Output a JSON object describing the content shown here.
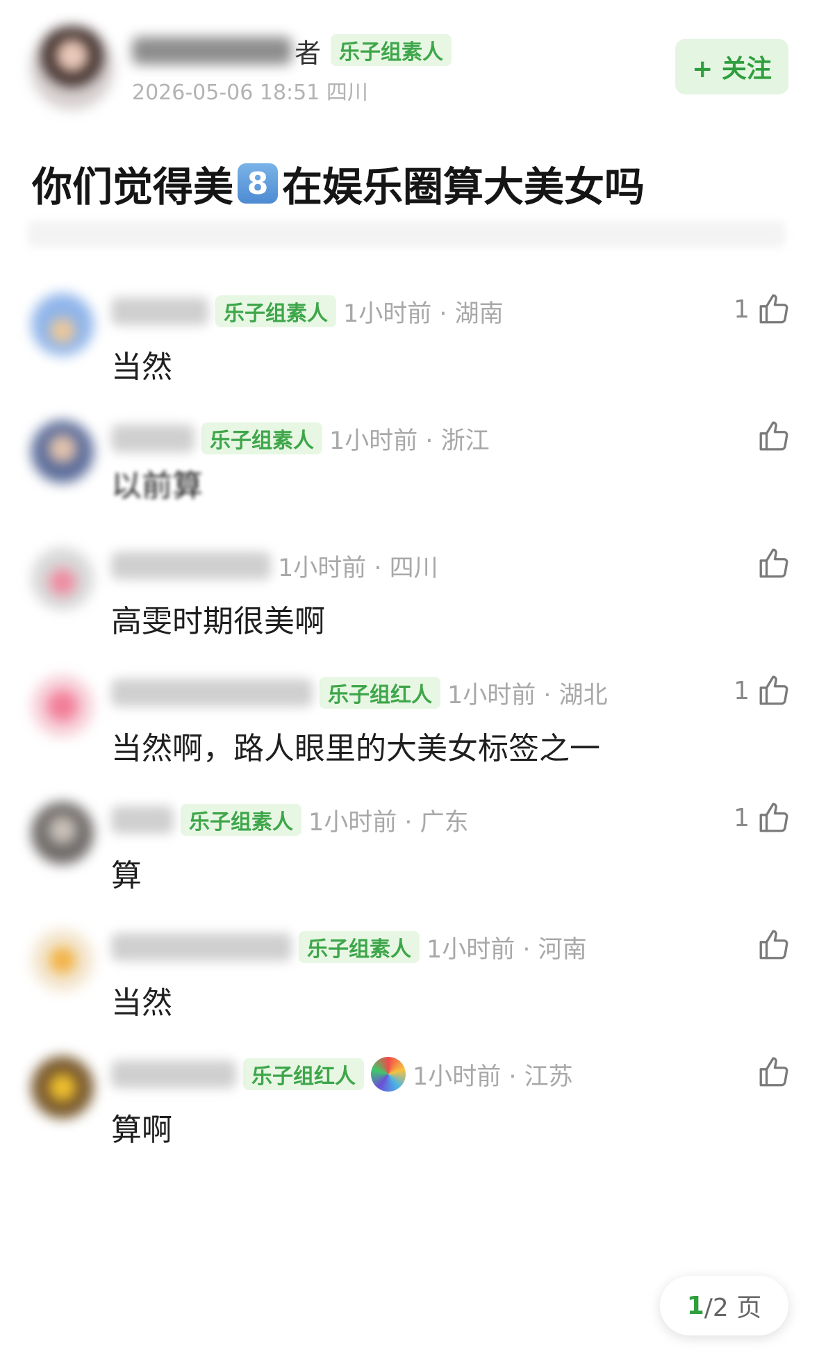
{
  "post": {
    "author_name_suffix": "者",
    "author_tag": "乐子组素人",
    "datetime": "2026-05-06 18:51",
    "location": "四川",
    "follow_label": "+ 关注",
    "title_before": "你们觉得美",
    "title_emoji": "8",
    "title_after": "在娱乐圈算大美女吗"
  },
  "comments": [
    {
      "tag": "乐子组素人",
      "time": "1小时前 · 湖南",
      "text": "当然",
      "likes": "1"
    },
    {
      "tag": "乐子组素人",
      "time": "1小时前 · 浙江",
      "text": "以前算",
      "likes": ""
    },
    {
      "tag": "",
      "time": "1小时前 · 四川",
      "text": "高雯时期很美啊",
      "likes": ""
    },
    {
      "tag": "乐子组红人",
      "time": "1小时前 · 湖北",
      "text": "当然啊，路人眼里的大美女标签之一",
      "likes": "1"
    },
    {
      "tag": "乐子组素人",
      "time": "1小时前 · 广东",
      "text": "算",
      "likes": "1"
    },
    {
      "tag": "乐子组素人",
      "time": "1小时前 · 河南",
      "text": "当然",
      "likes": ""
    },
    {
      "tag": "乐子组红人",
      "time": "1小时前 · 江苏",
      "text": "算啊",
      "likes": ""
    }
  ],
  "pagination": {
    "current": "1",
    "total_label": "/2 页"
  },
  "colors": {
    "accent_green": "#3ea64a",
    "tag_bg": "#e8f7e4",
    "meta_gray": "#a8a8a8"
  }
}
